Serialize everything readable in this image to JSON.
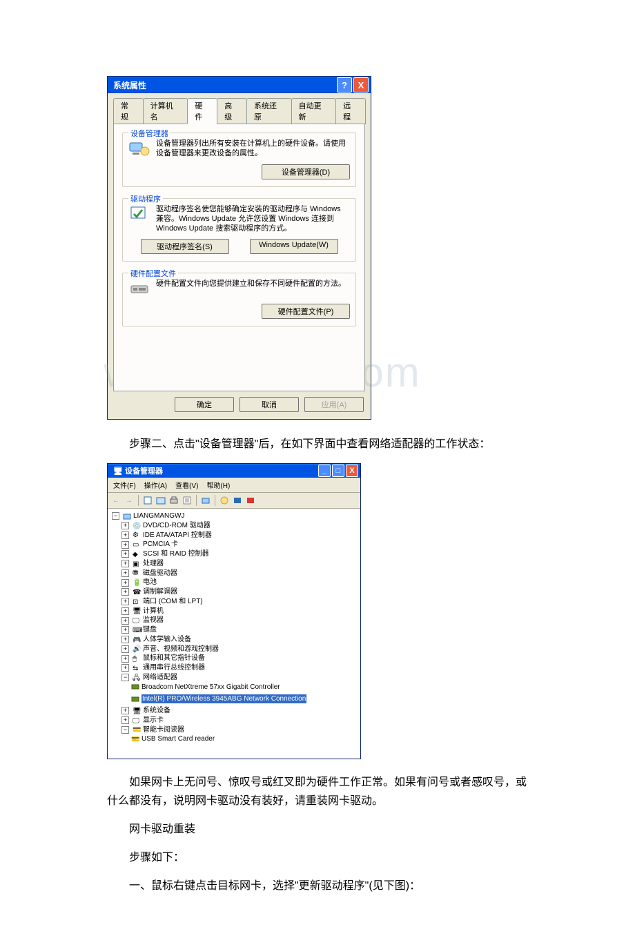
{
  "watermark": "www.bdocx.com",
  "dialog1": {
    "title": "系统属性",
    "help": "?",
    "close": "X",
    "tabs": {
      "t0": "常规",
      "t1": "计算机名",
      "t2": "硬件",
      "t3": "高级",
      "t4": "系统还原",
      "t5": "自动更新",
      "t6": "远程"
    },
    "group1": {
      "legend": "设备管理器",
      "text": "设备管理器列出所有安装在计算机上的硬件设备。请使用设备管理器来更改设备的属性。",
      "btn": "设备管理器(D)"
    },
    "group2": {
      "legend": "驱动程序",
      "text": "驱动程序签名使您能够确定安装的驱动程序与 Windows 兼容。Windows Update 允许您设置 Windows 连接到 Windows Update 搜索驱动程序的方式。",
      "btn1": "驱动程序签名(S)",
      "btn2": "Windows Update(W)"
    },
    "group3": {
      "legend": "硬件配置文件",
      "text": "硬件配置文件向您提供建立和保存不同硬件配置的方法。",
      "btn": "硬件配置文件(P)"
    },
    "bottom": {
      "ok": "确定",
      "cancel": "取消",
      "apply": "应用(A)"
    }
  },
  "para1": "步骤二、点击\"设备管理器\"后，在如下界面中查看网络适配器的工作状态：",
  "devmgr": {
    "title_icon": "🖥",
    "title": "设备管理器",
    "min": "_",
    "max": "□",
    "close": "X",
    "menu": {
      "file": "文件(F)",
      "action": "操作(A)",
      "view": "查看(V)",
      "help": "帮助(H)"
    },
    "nav": {
      "back": "←",
      "fwd": "→"
    },
    "root": "LIANGMANGWJ",
    "nodes": {
      "n0": "DVD/CD-ROM 驱动器",
      "n1": "IDE ATA/ATAPI 控制器",
      "n2": "PCMCIA 卡",
      "n3": "SCSI 和 RAID 控制器",
      "n4": "处理器",
      "n5": "磁盘驱动器",
      "n6": "电池",
      "n7": "调制解调器",
      "n8": "端口 (COM 和 LPT)",
      "n9": "计算机",
      "n10": "监视器",
      "n11": "键盘",
      "n12": "人体学输入设备",
      "n13": "声音、视频和游戏控制器",
      "n14": "鼠标和其它指针设备",
      "n15": "通用串行总线控制器",
      "n16": "网络适配器",
      "n16a": "Broadcom NetXtreme 57xx Gigabit Controller",
      "n16b": "Intel(R) PRO/Wireless 3945ABG Network Connection",
      "n17": "系统设备",
      "n18": "显示卡",
      "n19": "智能卡阅读器",
      "n19a": "USB Smart Card reader"
    }
  },
  "para2": "如果网卡上无问号、惊叹号或红叉即为硬件工作正常。如果有问号或者感叹号，或什么都没有，说明网卡驱动没有装好，请重装网卡驱动。",
  "para3": "网卡驱动重装",
  "para4": "步骤如下：",
  "para5": "一、鼠标右键点击目标网卡，选择\"更新驱动程序\"(见下图)："
}
